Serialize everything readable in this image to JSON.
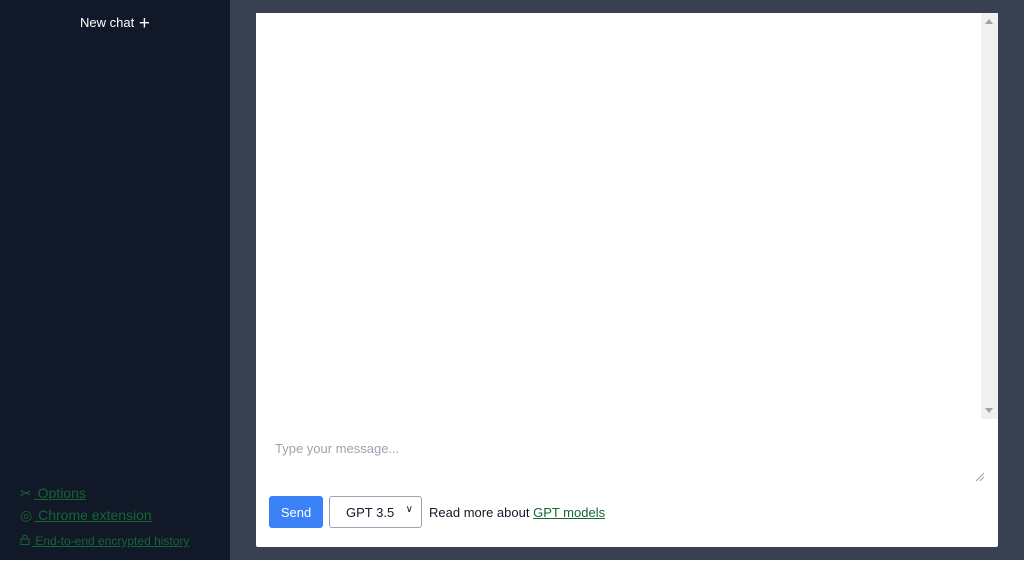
{
  "sidebar": {
    "new_chat_label": "New chat",
    "new_chat_icon": "+",
    "links": [
      {
        "icon": "tools-icon",
        "glyph": "✂",
        "label": " Options"
      },
      {
        "icon": "chrome-icon",
        "glyph": "◎",
        "label": " Chrome extension"
      },
      {
        "icon": "lock-icon",
        "glyph": "🔒︎",
        "label": " End-to-end encrypted history"
      }
    ]
  },
  "composer": {
    "placeholder": "Type your message...",
    "send_label": "Send",
    "model_selected": "GPT 3.5",
    "read_more_text": "Read more about ",
    "read_more_link": "GPT models"
  },
  "colors": {
    "sidebar_bg": "#111827",
    "main_bg": "#374151",
    "send_button": "#3b82f6",
    "link_green": "#166534"
  }
}
